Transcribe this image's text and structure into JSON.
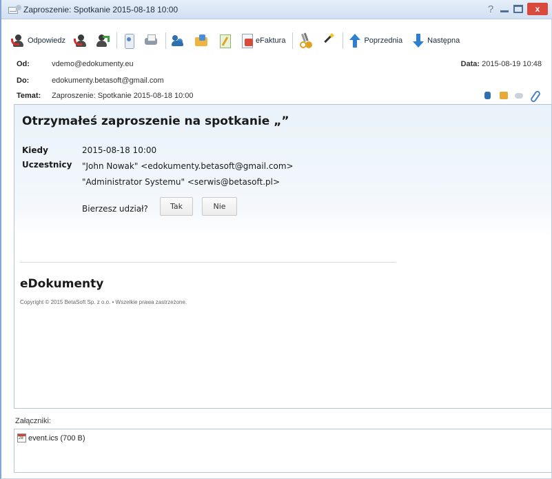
{
  "window": {
    "title": "Zaproszenie: Spotkanie 2015-08-18 10:00",
    "help_glyph": "?",
    "close_glyph": "x"
  },
  "toolbar": {
    "reply_label": "Odpowiedz",
    "efaktura_label": "eFaktura",
    "previous_label": "Poprzednia",
    "next_label": "Następna",
    "icons": [
      "reply-icon",
      "reply-all-icon",
      "forward-icon",
      "scroll-icon",
      "printer-icon",
      "users-icon",
      "folder-icon",
      "notes-icon",
      "invoice-icon",
      "scissors-icon",
      "magic-wand-icon",
      "arrow-up-icon",
      "arrow-down-icon"
    ]
  },
  "header": {
    "from_label": "Od:",
    "from_value": "vdemo@edokumenty.eu",
    "to_label": "Do:",
    "to_value": "edokumenty.betasoft@gmail.com",
    "subject_label": "Temat:",
    "subject_value": "Zaproszenie: Spotkanie 2015-08-18 10:00",
    "date_label": "Data:",
    "date_value": "2015-08-19 10:48"
  },
  "message": {
    "heading": "Otrzymałeś zaproszenie na spotkanie „”",
    "when_label": "Kiedy",
    "when_value": "2015-08-18 10:00",
    "participants_label": "Uczestnicy",
    "participants": [
      "\"John Nowak\" <edokumenty.betasoft@gmail.com>",
      "\"Administrator Systemu\" <serwis@betasoft.pl>"
    ],
    "question": "Bierzesz udział?",
    "yes_label": "Tak",
    "no_label": "Nie",
    "brand": "eDokumenty",
    "copyright": "Copyright © 2015 BetaSoft Sp. z o.o. • Wszelkie prawa zastrzeżone."
  },
  "attachments": {
    "label": "Załączniki:",
    "items": [
      {
        "name": "event.ics (700 B)",
        "icon": "calendar-file-icon"
      }
    ]
  }
}
